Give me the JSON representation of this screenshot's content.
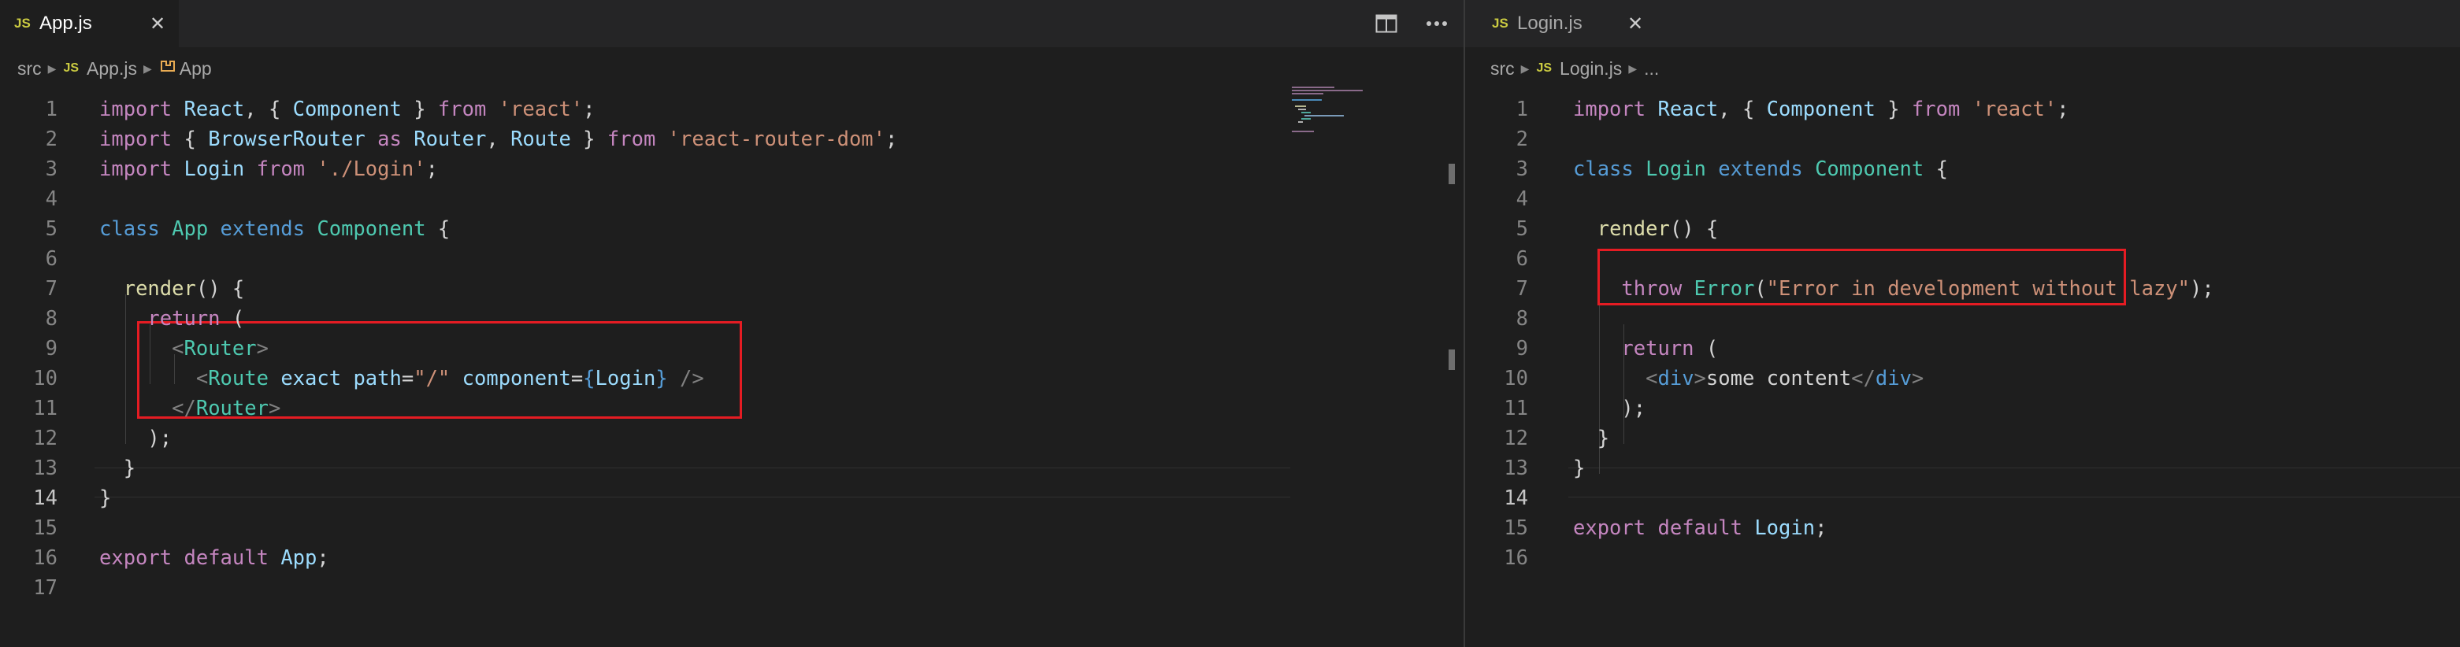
{
  "left_editor": {
    "tab": {
      "badge": "JS",
      "name": "App.js",
      "close": "✕"
    },
    "toolbar": {
      "split_icon": "split-editor-icon",
      "more_icon": "more-actions-icon"
    },
    "breadcrumb": {
      "folder": "src",
      "file_badge": "JS",
      "file": "App.js",
      "symbol_icon": "component-symbol-icon",
      "symbol": "App"
    },
    "current_line": "14",
    "lines": [
      {
        "n": "1",
        "t": [
          [
            "kw",
            "import"
          ],
          [
            "plain",
            " "
          ],
          [
            "var",
            "React"
          ],
          [
            "plain",
            ", { "
          ],
          [
            "var",
            "Component"
          ],
          [
            "plain",
            " } "
          ],
          [
            "kw",
            "from"
          ],
          [
            "plain",
            " "
          ],
          [
            "str",
            "'react'"
          ],
          [
            "plain",
            ";"
          ]
        ]
      },
      {
        "n": "2",
        "t": [
          [
            "kw",
            "import"
          ],
          [
            "plain",
            " { "
          ],
          [
            "var",
            "BrowserRouter"
          ],
          [
            "plain",
            " "
          ],
          [
            "kw",
            "as"
          ],
          [
            "plain",
            " "
          ],
          [
            "var",
            "Router"
          ],
          [
            "plain",
            ", "
          ],
          [
            "var",
            "Route"
          ],
          [
            "plain",
            " } "
          ],
          [
            "kw",
            "from"
          ],
          [
            "plain",
            " "
          ],
          [
            "str",
            "'react-router-dom'"
          ],
          [
            "plain",
            ";"
          ]
        ]
      },
      {
        "n": "3",
        "t": [
          [
            "kw",
            "import"
          ],
          [
            "plain",
            " "
          ],
          [
            "var",
            "Login"
          ],
          [
            "plain",
            " "
          ],
          [
            "kw",
            "from"
          ],
          [
            "plain",
            " "
          ],
          [
            "str",
            "'./Login'"
          ],
          [
            "plain",
            ";"
          ]
        ]
      },
      {
        "n": "4",
        "t": []
      },
      {
        "n": "5",
        "t": [
          [
            "cls",
            "class"
          ],
          [
            "plain",
            " "
          ],
          [
            "type",
            "App"
          ],
          [
            "plain",
            " "
          ],
          [
            "cls",
            "extends"
          ],
          [
            "plain",
            " "
          ],
          [
            "type",
            "Component"
          ],
          [
            "plain",
            " {"
          ]
        ]
      },
      {
        "n": "6",
        "t": []
      },
      {
        "n": "7",
        "t": [
          [
            "plain",
            "  "
          ],
          [
            "fn",
            "render"
          ],
          [
            "plain",
            "() {"
          ]
        ]
      },
      {
        "n": "8",
        "t": [
          [
            "plain",
            "    "
          ],
          [
            "kw",
            "return"
          ],
          [
            "plain",
            " ("
          ]
        ]
      },
      {
        "n": "9",
        "t": [
          [
            "plain",
            "      "
          ],
          [
            "tag",
            "<"
          ],
          [
            "type",
            "Router"
          ],
          [
            "tag",
            ">"
          ]
        ]
      },
      {
        "n": "10",
        "t": [
          [
            "plain",
            "        "
          ],
          [
            "tag",
            "<"
          ],
          [
            "type",
            "Route"
          ],
          [
            "plain",
            " "
          ],
          [
            "var",
            "exact"
          ],
          [
            "plain",
            " "
          ],
          [
            "var",
            "path"
          ],
          [
            "plain",
            "="
          ],
          [
            "str",
            "\"/\""
          ],
          [
            "plain",
            " "
          ],
          [
            "var",
            "component"
          ],
          [
            "plain",
            "="
          ],
          [
            "cls",
            "{"
          ],
          [
            "var",
            "Login"
          ],
          [
            "cls",
            "}"
          ],
          [
            "plain",
            " "
          ],
          [
            "tag",
            "/>"
          ]
        ]
      },
      {
        "n": "11",
        "t": [
          [
            "plain",
            "      "
          ],
          [
            "tag",
            "</"
          ],
          [
            "type",
            "Router"
          ],
          [
            "tag",
            ">"
          ]
        ]
      },
      {
        "n": "12",
        "t": [
          [
            "plain",
            "    );"
          ]
        ]
      },
      {
        "n": "13",
        "t": [
          [
            "plain",
            "  }"
          ]
        ]
      },
      {
        "n": "14",
        "t": [
          [
            "plain",
            "}"
          ]
        ]
      },
      {
        "n": "15",
        "t": []
      },
      {
        "n": "16",
        "t": [
          [
            "kw",
            "export"
          ],
          [
            "plain",
            " "
          ],
          [
            "kw",
            "default"
          ],
          [
            "plain",
            " "
          ],
          [
            "var",
            "App"
          ],
          [
            "plain",
            ";"
          ]
        ]
      },
      {
        "n": "17",
        "t": []
      }
    ]
  },
  "right_editor": {
    "tab": {
      "badge": "JS",
      "name": "Login.js",
      "close": "✕"
    },
    "breadcrumb": {
      "folder": "src",
      "file_badge": "JS",
      "file": "Login.js",
      "symbol": "..."
    },
    "current_line": "14",
    "lines": [
      {
        "n": "1",
        "t": [
          [
            "kw",
            "import"
          ],
          [
            "plain",
            " "
          ],
          [
            "var",
            "React"
          ],
          [
            "plain",
            ", { "
          ],
          [
            "var",
            "Component"
          ],
          [
            "plain",
            " } "
          ],
          [
            "kw",
            "from"
          ],
          [
            "plain",
            " "
          ],
          [
            "str",
            "'react'"
          ],
          [
            "plain",
            ";"
          ]
        ]
      },
      {
        "n": "2",
        "t": []
      },
      {
        "n": "3",
        "t": [
          [
            "cls",
            "class"
          ],
          [
            "plain",
            " "
          ],
          [
            "type",
            "Login"
          ],
          [
            "plain",
            " "
          ],
          [
            "cls",
            "extends"
          ],
          [
            "plain",
            " "
          ],
          [
            "type",
            "Component"
          ],
          [
            "plain",
            " {"
          ]
        ]
      },
      {
        "n": "4",
        "t": []
      },
      {
        "n": "5",
        "t": [
          [
            "plain",
            "  "
          ],
          [
            "fn",
            "render"
          ],
          [
            "plain",
            "() {"
          ]
        ]
      },
      {
        "n": "6",
        "t": []
      },
      {
        "n": "7",
        "t": [
          [
            "plain",
            "    "
          ],
          [
            "kw",
            "throw"
          ],
          [
            "plain",
            " "
          ],
          [
            "type",
            "Error"
          ],
          [
            "plain",
            "("
          ],
          [
            "str",
            "\"Error in development without lazy\""
          ],
          [
            "plain",
            ");"
          ]
        ]
      },
      {
        "n": "8",
        "t": []
      },
      {
        "n": "9",
        "t": [
          [
            "plain",
            "    "
          ],
          [
            "kw",
            "return"
          ],
          [
            "plain",
            " ("
          ]
        ]
      },
      {
        "n": "10",
        "t": [
          [
            "plain",
            "      "
          ],
          [
            "tag",
            "<"
          ],
          [
            "cls",
            "div"
          ],
          [
            "tag",
            ">"
          ],
          [
            "plain",
            "some content"
          ],
          [
            "tag",
            "</"
          ],
          [
            "cls",
            "div"
          ],
          [
            "tag",
            ">"
          ]
        ]
      },
      {
        "n": "11",
        "t": [
          [
            "plain",
            "    );"
          ]
        ]
      },
      {
        "n": "12",
        "t": [
          [
            "plain",
            "  }"
          ]
        ]
      },
      {
        "n": "13",
        "t": [
          [
            "plain",
            "}"
          ]
        ]
      },
      {
        "n": "14",
        "t": []
      },
      {
        "n": "15",
        "t": [
          [
            "kw",
            "export"
          ],
          [
            "plain",
            " "
          ],
          [
            "kw",
            "default"
          ],
          [
            "plain",
            " "
          ],
          [
            "var",
            "Login"
          ],
          [
            "plain",
            ";"
          ]
        ]
      },
      {
        "n": "16",
        "t": []
      }
    ]
  },
  "colors": {
    "keyword": "#c586c0",
    "storage": "#569cd6",
    "type": "#4ec9b0",
    "variable": "#9cdcfe",
    "string": "#ce9178",
    "function": "#dcdcaa",
    "tag_punctuation": "#808080",
    "highlight_box": "#e51c23",
    "editor_bg": "#1e1e1e"
  }
}
